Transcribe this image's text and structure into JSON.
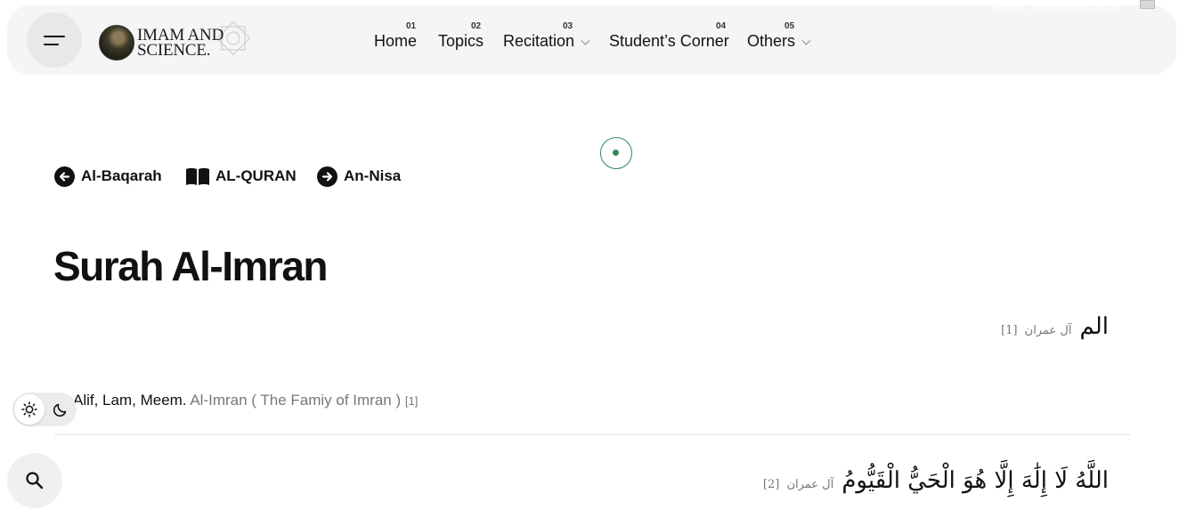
{
  "header": {
    "logo_line1": "IMAM AND",
    "logo_line2": "SCIENCE.",
    "nav": [
      {
        "num": "01",
        "label": "Home",
        "has_dropdown": false
      },
      {
        "num": "02",
        "label": "Topics",
        "has_dropdown": false
      },
      {
        "num": "03",
        "label": "Recitation",
        "has_dropdown": true
      },
      {
        "num": "04",
        "label": "Student’s Corner",
        "has_dropdown": false
      },
      {
        "num": "05",
        "label": "Others",
        "has_dropdown": true
      }
    ],
    "user_text": "Howdy, imamandscience"
  },
  "surah_nav": {
    "prev": "Al-Baqarah",
    "index": "AL-QURAN",
    "next": "An-Nisa"
  },
  "page_title": "Surah Al-Imran",
  "ayahs": [
    {
      "arabic": "الم",
      "ref": "آل عمران",
      "num": "[1]"
    },
    {
      "arabic": "اللَّهُ لَا إِلَٰهَ إِلَّا هُوَ الْحَيُّ الْقَيُّومُ",
      "ref": "آل عمران",
      "num": "[2]"
    }
  ],
  "translation_1": {
    "text": "Alif, Lam, Meem.",
    "source": "Al-Imran ( The Famiy of Imran )",
    "num": "[1]"
  },
  "colors": {
    "accent": "#2e8b57",
    "header_bg": "#f5f5f5",
    "text": "#111111",
    "muted": "#777777"
  },
  "icons": [
    "menu-icon",
    "arrow-left-circle-icon",
    "book-open-icon",
    "arrow-right-circle-icon",
    "sun-icon",
    "moon-icon",
    "search-icon",
    "loader-dot-icon"
  ]
}
